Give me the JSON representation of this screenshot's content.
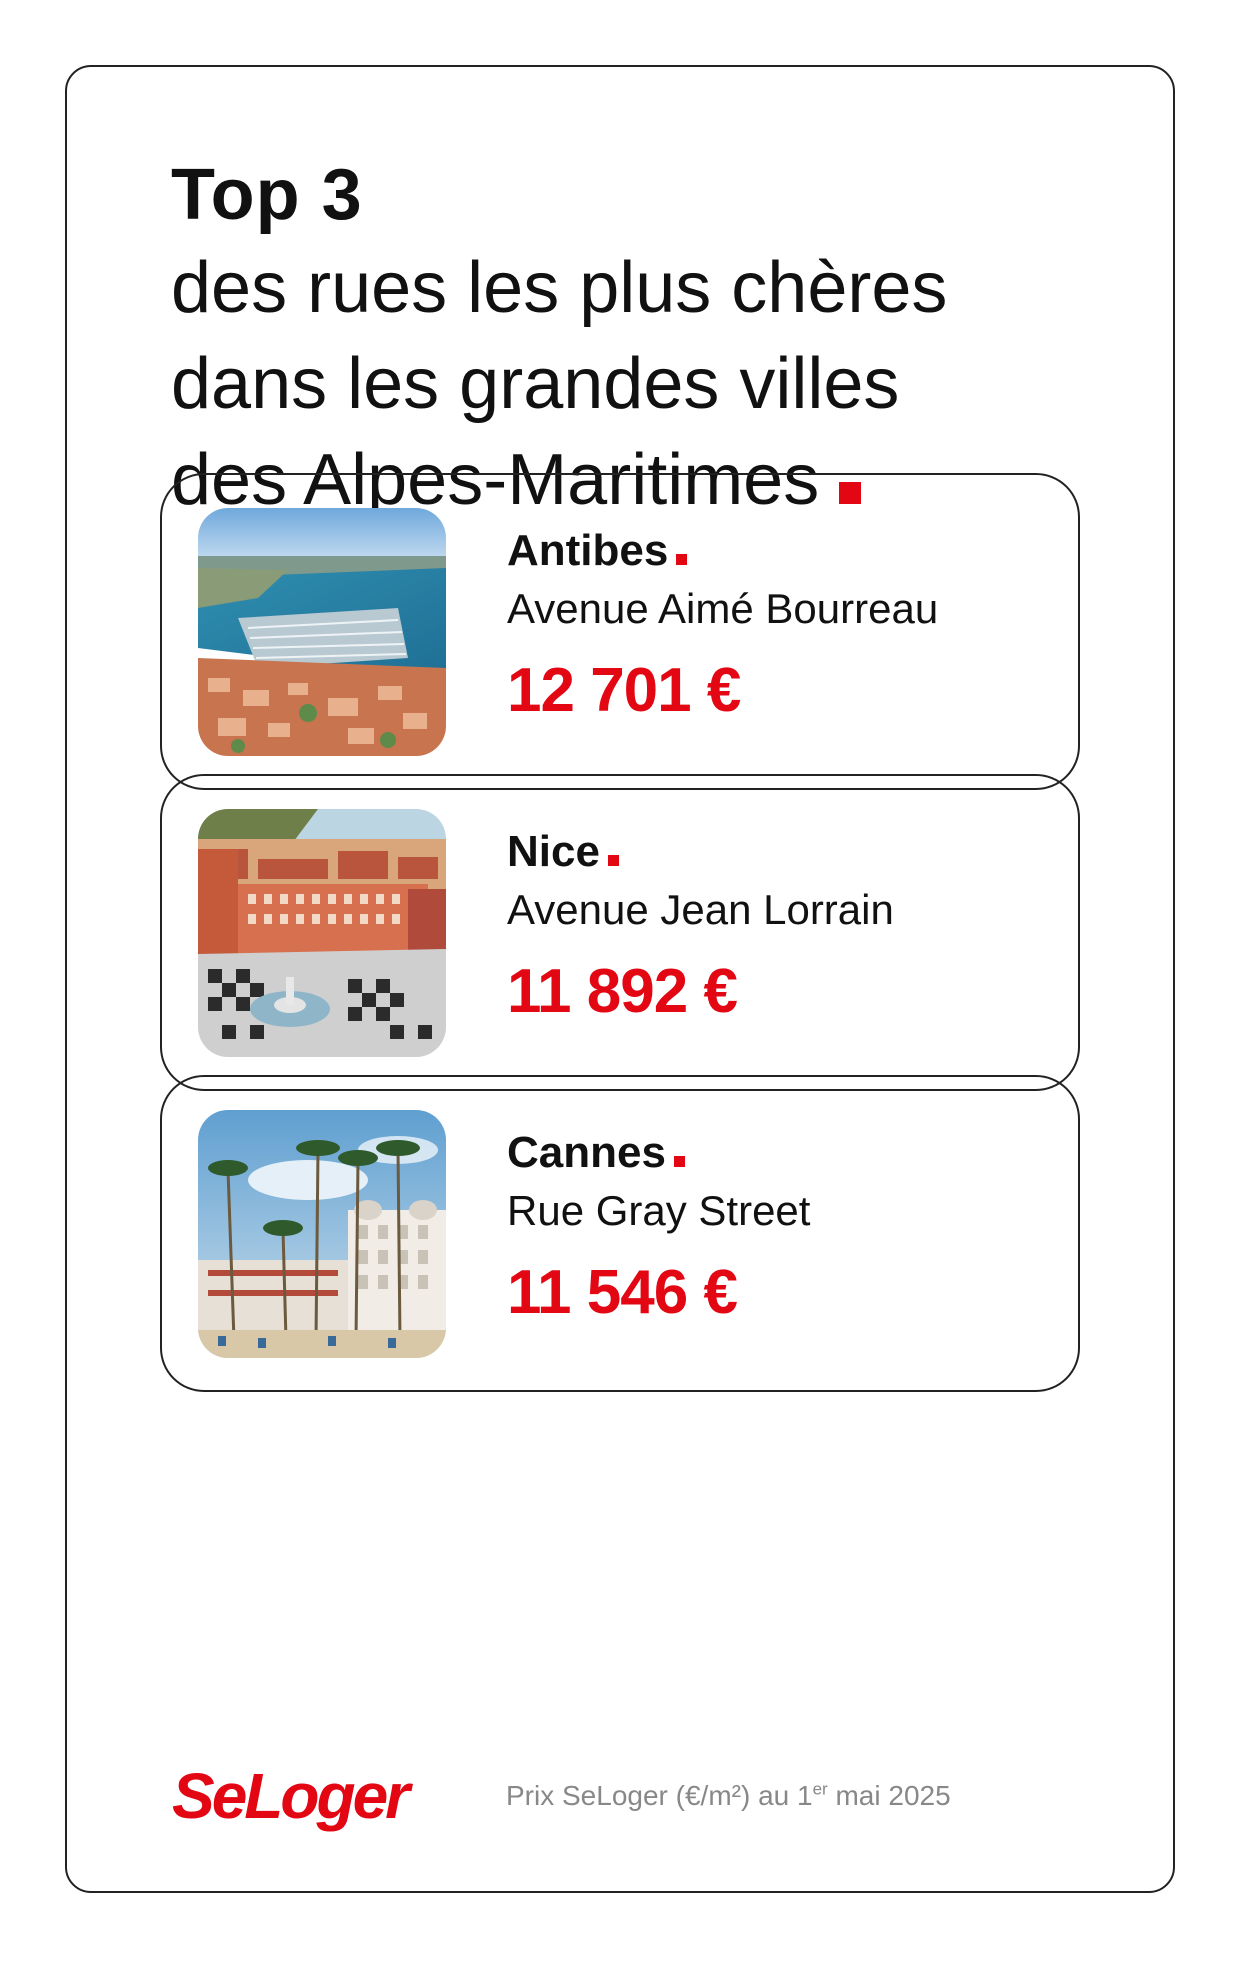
{
  "header": {
    "title": "Top 3",
    "subtitle_lines": [
      "des rues les plus chères",
      "dans les grandes villes",
      "des Alpes-Maritimes"
    ]
  },
  "cards": [
    {
      "city": "Antibes",
      "street": "Avenue Aimé Bourreau",
      "price": "12 701 €",
      "image_desc": "aerial-harbor-photo"
    },
    {
      "city": "Nice",
      "street": "Avenue Jean Lorrain",
      "price": "11 892 €",
      "image_desc": "aerial-square-fountain-photo"
    },
    {
      "city": "Cannes",
      "street": "Rue Gray Street",
      "price": "11 546 €",
      "image_desc": "palm-trees-hotel-photo"
    }
  ],
  "footer": {
    "logo": "SeLoger",
    "source_prefix": "Prix SeLoger (€/m²) au 1",
    "source_sup": "er",
    "source_suffix": " mai 2025"
  },
  "colors": {
    "accent": "#e30613",
    "text": "#111111",
    "muted": "#888888"
  }
}
